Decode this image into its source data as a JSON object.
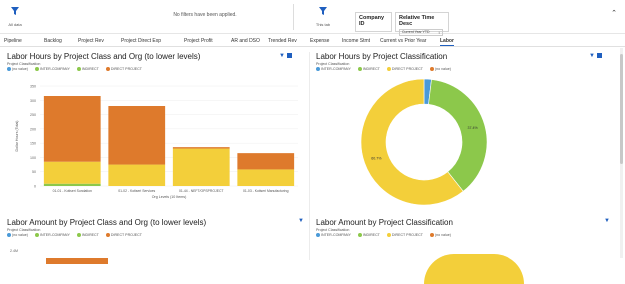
{
  "topbar": {
    "filter_left_caption": "All data",
    "no_filters": "No filters have been applied.",
    "filter_right_caption": "This tab",
    "cards": [
      {
        "label": "Company ID",
        "value": ""
      },
      {
        "label": "Relative Time Desc",
        "value": "Current Year YTD"
      }
    ]
  },
  "tabs": [
    "Pipeline",
    "Backlog",
    "Project Rev",
    "Project Direct Exp",
    "Project Profit",
    "AR and DSO",
    "Trended Rev",
    "Expense",
    "Income Stmt",
    "Current vs Prior Year",
    "Labor"
  ],
  "active_tab": "Labor",
  "colors": {
    "direct_project": "#de7a2c",
    "indirect": "#8cc84b",
    "no_value": "#f3cf3a",
    "inter_company": "#4a9ad8",
    "accent": "#1f5fbf"
  },
  "panels": {
    "labor_hours_class_org": {
      "title": "Labor Hours by Project Class and Org (to lower levels)",
      "legend_head": "Project Classification",
      "legend": [
        "(no value)",
        "INTER-COMPANY",
        "INDIRECT",
        "DIRECT PROJECT"
      ]
    },
    "labor_hours_class": {
      "title": "Labor Hours by Project Classification",
      "legend_head": "Project Classification",
      "legend": [
        "INTER-COMPANY",
        "INDIRECT",
        "DIRECT PROJECT",
        "(no value)"
      ]
    },
    "labor_amount_class_org": {
      "title": "Labor Amount by Project Class and Org (to lower levels)",
      "legend_head": "Project Classification",
      "legend": [
        "(no value)",
        "INTER-COMPANY",
        "INDIRECT",
        "DIRECT PROJECT"
      ],
      "first_tick": "2.4M"
    },
    "labor_amount_class": {
      "title": "Labor Amount by Project Classification",
      "legend_head": "Project Classification",
      "legend": [
        "INTER-COMPANY",
        "INDIRECT",
        "DIRECT PROJECT",
        "(no value)"
      ]
    }
  },
  "chart_data": [
    {
      "type": "bar",
      "title": "Labor Hours by Project Class and Org (to lower levels)",
      "xlabel": "Org Levels (10 Items)",
      "ylabel": "Dollar Hours (Total)",
      "ylim": [
        0,
        350
      ],
      "yticks": [
        "0",
        "50",
        "100",
        "150",
        "200",
        "250",
        "300",
        "350"
      ],
      "categories": [
        "01-01 - Kotiseri Sundation",
        "01-02 - Kotiseri Services",
        "01-44 - NEFT/OPSPROJECT",
        "01-03 - Kotiseri Manufacturing"
      ],
      "series": [
        {
          "name": "INDIRECT",
          "values": [
            8,
            0,
            0,
            0
          ]
        },
        {
          "name": "INTER-COMPANY",
          "values": [
            0,
            0,
            0,
            0
          ]
        },
        {
          "name": "(no value)",
          "values": [
            77,
            75,
            131,
            58
          ]
        },
        {
          "name": "DIRECT PROJECT",
          "values": [
            230,
            205,
            5,
            57
          ]
        }
      ]
    },
    {
      "type": "pie",
      "title": "Labor Hours by Project Classification",
      "labels": [
        "INTER-COMPANY",
        "INDIRECT",
        "DIRECT PROJECT",
        "(no value)"
      ],
      "values": [
        1.9,
        37.4,
        60.7,
        0
      ],
      "data_labels": [
        "",
        "37.4%",
        "60.7%",
        ""
      ]
    }
  ]
}
